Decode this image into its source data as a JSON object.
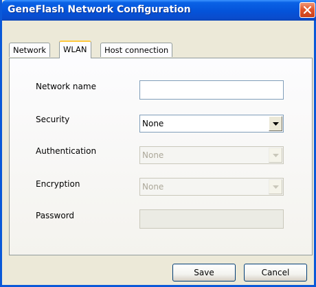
{
  "window": {
    "title": "GeneFlash Network Configuration",
    "close_icon": "close-icon",
    "colors": {
      "titlebar": "#0453d9",
      "close": "#e2562c",
      "face": "#ece9d8"
    }
  },
  "tabs": [
    {
      "label": "Network",
      "active": false
    },
    {
      "label": "WLAN",
      "active": true
    },
    {
      "label": "Host connection",
      "active": false
    }
  ],
  "form": {
    "network_name": {
      "label": "Network name",
      "value": ""
    },
    "security": {
      "label": "Security",
      "value": "None",
      "enabled": true
    },
    "authentication": {
      "label": "Authentication",
      "value": "None",
      "enabled": false
    },
    "encryption": {
      "label": "Encryption",
      "value": "None",
      "enabled": false
    },
    "password": {
      "label": "Password",
      "value": "",
      "enabled": false
    }
  },
  "buttons": {
    "save": "Save",
    "cancel": "Cancel"
  }
}
